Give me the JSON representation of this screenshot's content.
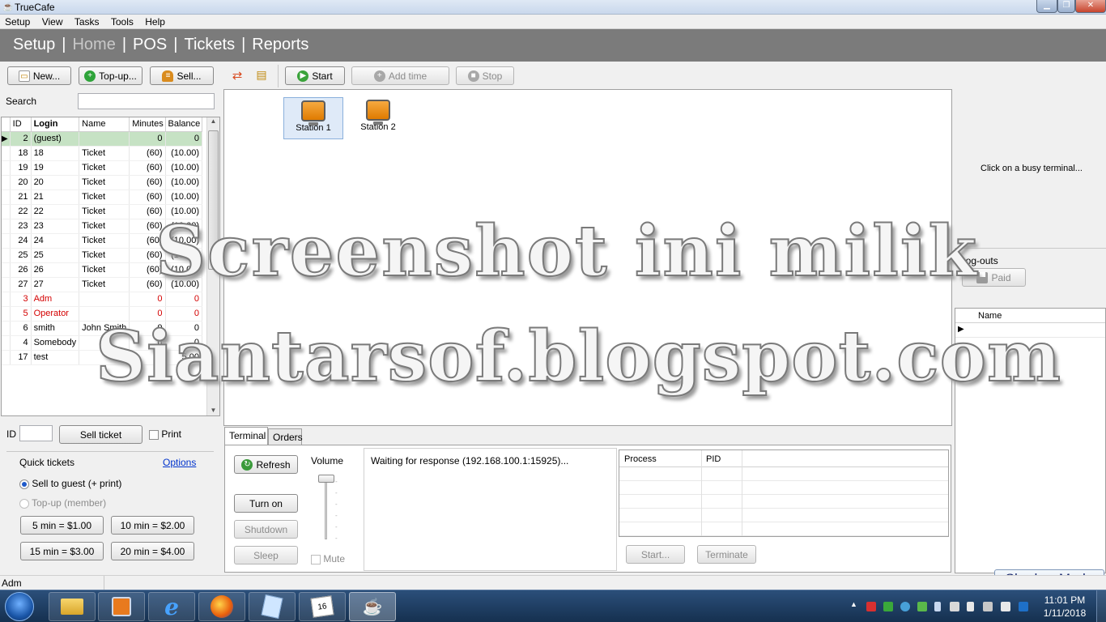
{
  "window": {
    "title": "TrueCafe"
  },
  "menu": [
    "Setup",
    "View",
    "Tasks",
    "Tools",
    "Help"
  ],
  "nav": {
    "items": [
      "Setup",
      "Home",
      "POS",
      "Tickets",
      "Reports"
    ],
    "active": "Home"
  },
  "left_toolbar": {
    "new_label": "New...",
    "topup_label": "Top-up...",
    "sell_label": "Sell..."
  },
  "search": {
    "label": "Search",
    "value": ""
  },
  "users_table": {
    "columns": [
      "ID",
      "Login",
      "Name",
      "Minutes",
      "Balance"
    ],
    "rows": [
      {
        "id": "2",
        "login": "(guest)",
        "name": "",
        "minutes": "0",
        "balance": "0"
      },
      {
        "id": "18",
        "login": "18",
        "name": "Ticket",
        "minutes": "(60)",
        "balance": "(10.00)"
      },
      {
        "id": "19",
        "login": "19",
        "name": "Ticket",
        "minutes": "(60)",
        "balance": "(10.00)"
      },
      {
        "id": "20",
        "login": "20",
        "name": "Ticket",
        "minutes": "(60)",
        "balance": "(10.00)"
      },
      {
        "id": "21",
        "login": "21",
        "name": "Ticket",
        "minutes": "(60)",
        "balance": "(10.00)"
      },
      {
        "id": "22",
        "login": "22",
        "name": "Ticket",
        "minutes": "(60)",
        "balance": "(10.00)"
      },
      {
        "id": "23",
        "login": "23",
        "name": "Ticket",
        "minutes": "(60)",
        "balance": "(10.00)"
      },
      {
        "id": "24",
        "login": "24",
        "name": "Ticket",
        "minutes": "(60)",
        "balance": "(10.00)"
      },
      {
        "id": "25",
        "login": "25",
        "name": "Ticket",
        "minutes": "(60)",
        "balance": "(10.00)"
      },
      {
        "id": "26",
        "login": "26",
        "name": "Ticket",
        "minutes": "(60)",
        "balance": "(10.00)"
      },
      {
        "id": "27",
        "login": "27",
        "name": "Ticket",
        "minutes": "(60)",
        "balance": "(10.00)"
      },
      {
        "id": "3",
        "login": "Adm",
        "name": "",
        "minutes": "0",
        "balance": "0"
      },
      {
        "id": "5",
        "login": "Operator",
        "name": "",
        "minutes": "0",
        "balance": "0"
      },
      {
        "id": "6",
        "login": "smith",
        "name": "John Smith",
        "minutes": "0",
        "balance": "0"
      },
      {
        "id": "4",
        "login": "Somebody",
        "name": "",
        "minutes": "0",
        "balance": "0"
      },
      {
        "id": "17",
        "login": "test",
        "name": "",
        "minutes": "0",
        "balance": "5.00"
      }
    ]
  },
  "ticket": {
    "id_label": "ID",
    "id_value": "",
    "sell_label": "Sell ticket",
    "print_label": "Print"
  },
  "quick_tickets": {
    "title": "Quick tickets",
    "options_link": "Options",
    "radio_sell": "Sell to guest (+ print)",
    "radio_topup": "Top-up (member)",
    "buttons": [
      "5 min = $1.00",
      "10 min = $2.00",
      "15 min = $3.00",
      "20 min = $4.00"
    ]
  },
  "center_toolbar": {
    "start_label": "Start",
    "addtime_label": "Add time",
    "stop_label": "Stop"
  },
  "stations": [
    "Station 1",
    "Station 2"
  ],
  "tabs": [
    "Terminal",
    "Orders"
  ],
  "terminal": {
    "refresh_label": "Refresh",
    "turnon_label": "Turn on",
    "shutdown_label": "Shutdown",
    "sleep_label": "Sleep",
    "volume_label": "Volume",
    "mute_label": "Mute",
    "log_text": "Waiting for response (192.168.100.1:15925)...",
    "process_columns": [
      "Process",
      "PID"
    ],
    "start_label": "Start...",
    "terminate_label": "Terminate"
  },
  "right_panel": {
    "hint": "Click on a busy terminal...",
    "logouts_label": "Log-outs",
    "paid_label": "Paid",
    "names_column": "Name"
  },
  "shadow_mode_label": "Shadow Mode",
  "status_text": "Adm",
  "clock": {
    "time": "11:01 PM",
    "date": "1/11/2018"
  },
  "watermark": {
    "line1": "Screenshot ini milik",
    "line2": "Siantarsof.blogspot.com"
  },
  "colors": {
    "nav_bg": "#7b7b7b",
    "selected_row": "#c6e2c4",
    "special_user_text": "#d40000",
    "taskbar": "#1e3e64"
  }
}
